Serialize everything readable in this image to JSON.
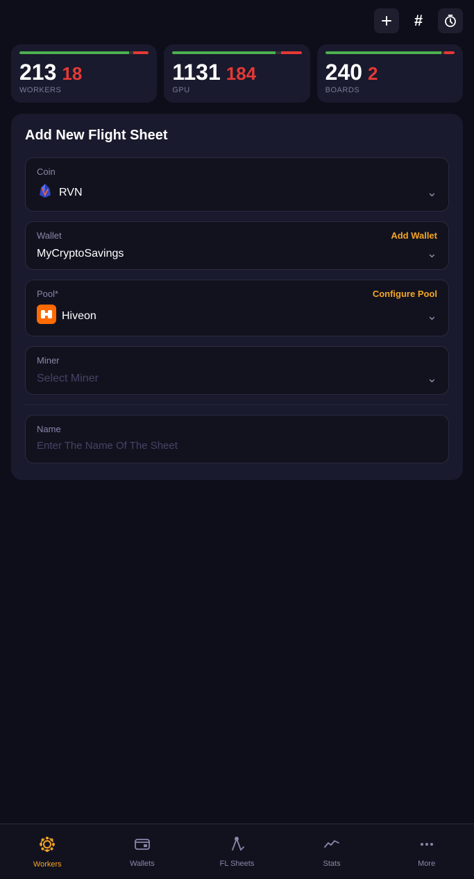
{
  "topBar": {
    "addIcon": "+",
    "hashIcon": "#",
    "timerIcon": "⏱"
  },
  "stats": [
    {
      "main": "213",
      "sub": "18",
      "label": "WORKERS",
      "greenWidth": "85%",
      "redWidth": "15%"
    },
    {
      "main": "1131",
      "sub": "184",
      "label": "GPU",
      "greenWidth": "80%",
      "redWidth": "20%"
    },
    {
      "main": "240",
      "sub": "2",
      "label": "BOARDS",
      "greenWidth": "90%",
      "redWidth": "10%"
    }
  ],
  "form": {
    "title": "Add New Flight Sheet",
    "coin": {
      "label": "Coin",
      "value": "RVN"
    },
    "wallet": {
      "label": "Wallet",
      "action": "Add Wallet",
      "value": "MyCryptoSavings"
    },
    "pool": {
      "label": "Pool*",
      "action": "Configure Pool",
      "value": "Hiveon"
    },
    "miner": {
      "label": "Miner",
      "value": "Select Miner"
    },
    "name": {
      "label": "Name",
      "placeholder": "Enter The Name Of The Sheet"
    }
  },
  "bottomNav": {
    "items": [
      {
        "label": "Workers",
        "icon": "workers",
        "active": true
      },
      {
        "label": "Wallets",
        "icon": "wallets",
        "active": false
      },
      {
        "label": "FL Sheets",
        "icon": "flsheets",
        "active": false
      },
      {
        "label": "Stats",
        "icon": "stats",
        "active": false
      },
      {
        "label": "More",
        "icon": "more",
        "active": false
      }
    ]
  }
}
